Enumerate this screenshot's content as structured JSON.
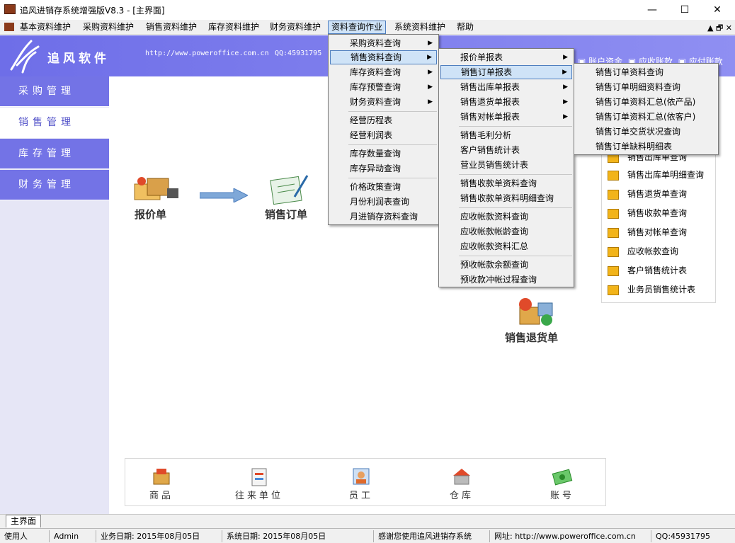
{
  "window": {
    "title": "追风进销存系统增强版V8.3 - [主界面]",
    "min": "—",
    "max": "☐",
    "close": "✕"
  },
  "menubar": {
    "items": [
      "基本资料维护",
      "采购资料维护",
      "销售资料维护",
      "库存资料维护",
      "财务资料维护",
      "资料查询作业",
      "系统资料维护",
      "帮助"
    ],
    "active_index": 5,
    "mdi": "▲ 🗗 ✕"
  },
  "banner": {
    "brand": "追风软件",
    "url": "http://www.poweroffice.com.cn",
    "qq": "QQ:45931795",
    "links": [
      "账户资金",
      "应收账款",
      "应付账款"
    ]
  },
  "sidebar": {
    "items": [
      "采购管理",
      "销售管理",
      "库存管理",
      "财务管理"
    ],
    "selected_index": 1
  },
  "flow": {
    "quote": "报价单",
    "order": "销售订单",
    "return": "销售退货单"
  },
  "right_panel": {
    "items": [
      "销售出库单查询",
      "销售出库单明细查询",
      "销售退货单查询",
      "销售收款单查询",
      "销售对帐单查询",
      "应收帐款查询",
      "客户销售统计表",
      "业务员销售统计表"
    ]
  },
  "bottom": {
    "items": [
      "商品",
      "往来单位",
      "员工",
      "仓库",
      "账号"
    ]
  },
  "menu1": {
    "items": [
      "采购资料查询",
      "销售资料查询",
      "库存资料查询",
      "库存预警查询",
      "财务资料查询",
      "经营历程表",
      "经营利润表",
      "库存数量查询",
      "库存异动查询",
      "价格政策查询",
      "月份利润表查询",
      "月进销存资料查询"
    ]
  },
  "menu2": {
    "items": [
      "报价单报表",
      "销售订单报表",
      "销售出库单报表",
      "销售退货单报表",
      "销售对帐单报表",
      "销售毛利分析",
      "客户销售统计表",
      "营业员销售统计表",
      "销售收款单资料查询",
      "销售收款单资料明细查询",
      "应收帐款资料查询",
      "应收帐款帐龄查询",
      "应收帐款资料汇总",
      "预收帐款余额查询",
      "预收款冲帐过程查询"
    ]
  },
  "menu3": {
    "items": [
      "销售订单资料查询",
      "销售订单明细资料查询",
      "销售订单资料汇总(依产品)",
      "销售订单资料汇总(依客户)",
      "销售订单交货状况查询",
      "销售订单缺料明细表"
    ]
  },
  "tabs": {
    "main": "主界面"
  },
  "status": {
    "user_label": "使用人",
    "user": "Admin",
    "biz_date": "业务日期: 2015年08月05日",
    "sys_date": "系统日期: 2015年08月05日",
    "thanks": "感谢您使用追风进销存系统",
    "site": "网址: http://www.poweroffice.com.cn",
    "qq": "QQ:45931795"
  },
  "colors": {
    "accent": "#7373e6",
    "menu_highlight": "#cfe3f7"
  }
}
